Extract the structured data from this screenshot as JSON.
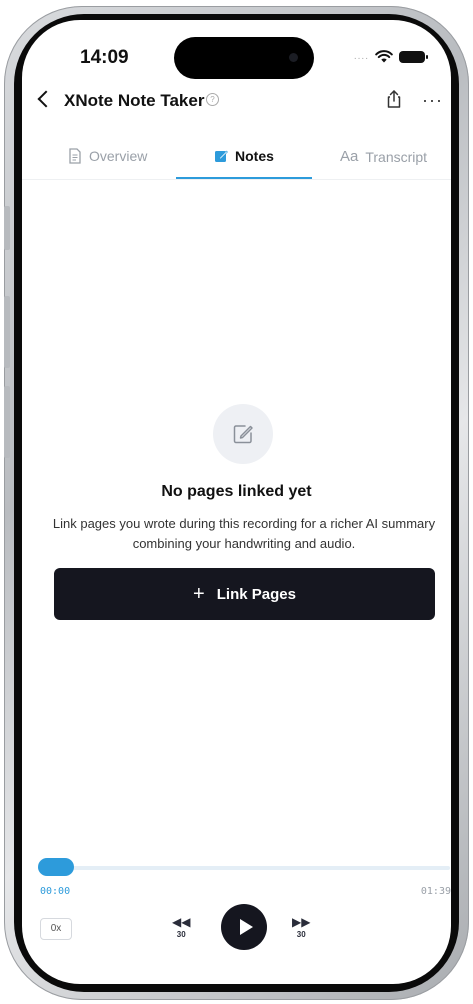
{
  "status_bar": {
    "time": "14:09",
    "signal": "....",
    "wifi_icon": "wifi-icon",
    "battery_icon": "battery-icon"
  },
  "header": {
    "title": "XNote Note Taker",
    "help_icon": "?",
    "share_icon": "share-icon",
    "more_icon": "···"
  },
  "tabs": [
    {
      "label": "Overview",
      "icon": "document-icon",
      "active": false
    },
    {
      "label": "Notes",
      "icon": "edit-icon",
      "active": true
    },
    {
      "label": "Transcript",
      "icon_text": "Aa",
      "active": false
    }
  ],
  "empty_state": {
    "icon": "edit-icon",
    "title": "No pages linked yet",
    "description": "Link pages you wrote during this recording for a richer AI summary combining your handwriting and audio."
  },
  "link_button": {
    "icon": "+",
    "label": "Link Pages"
  },
  "player": {
    "current_time": "00:00",
    "total_time": "01:39",
    "progress": 0,
    "speed": "0x",
    "skip_back_label": "30",
    "skip_forward_label": "30",
    "play_icon": "play-icon"
  },
  "colors": {
    "accent": "#2d9bdb",
    "button_dark": "#15161f",
    "muted_text": "#9aa0a8"
  }
}
